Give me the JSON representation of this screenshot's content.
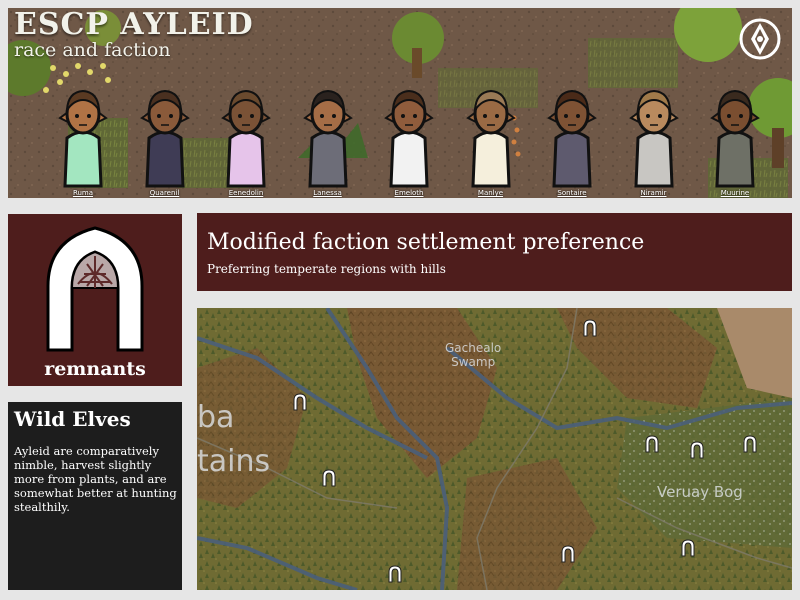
{
  "banner": {
    "brand_line1": "ESCP AYLEID",
    "brand_line2": "race and faction",
    "pawns": [
      {
        "name": "Ruma",
        "skin": "#b07345",
        "hair": "#5a3a22",
        "outfit": "#a3e6c0"
      },
      {
        "name": "Quarenil",
        "skin": "#8a5a3a",
        "hair": "#4a3020",
        "outfit": "#3f3c55"
      },
      {
        "name": "Eenedolin",
        "skin": "#7a5236",
        "hair": "#6a4a2e",
        "outfit": "#e6c4ea"
      },
      {
        "name": "Lanessa",
        "skin": "#a56d46",
        "hair": "#2a221e",
        "outfit": "#6d6d78"
      },
      {
        "name": "Emeloth",
        "skin": "#8f5c3c",
        "hair": "#4a2e1c",
        "outfit": "#f2f2f2"
      },
      {
        "name": "Manlye",
        "skin": "#9a6a44",
        "hair": "#9a7a56",
        "outfit": "#f5efdc"
      },
      {
        "name": "Sontaire",
        "skin": "#7e5234",
        "hair": "#4a2a18",
        "outfit": "#5e5a6e"
      },
      {
        "name": "Niramir",
        "skin": "#b98a5e",
        "hair": "#a07a4a",
        "outfit": "#c8c6c2"
      },
      {
        "name": "Muurine",
        "skin": "#7a4e30",
        "hair": "#3a2a1e",
        "outfit": "#6e7066"
      }
    ]
  },
  "ideoligion": {
    "label": "remnants"
  },
  "race": {
    "title": "Wild Elves",
    "description": "Ayleid are comparatively nimble, harvest slightly more from plants, and are somewhat better at hunting stealthily."
  },
  "feature": {
    "title": "Modified faction settlement preference",
    "subtitle": "Preferring temperate regions with hills"
  },
  "map": {
    "labels": {
      "gachealo": "Gachealo\nSwamp",
      "veruay": "Veruay Bog",
      "ba": "ba",
      "tains": "tains"
    }
  },
  "colors": {
    "panel_red": "#4e1d1c",
    "panel_dark": "#1d1d1d",
    "background": "#e6e6e6"
  }
}
